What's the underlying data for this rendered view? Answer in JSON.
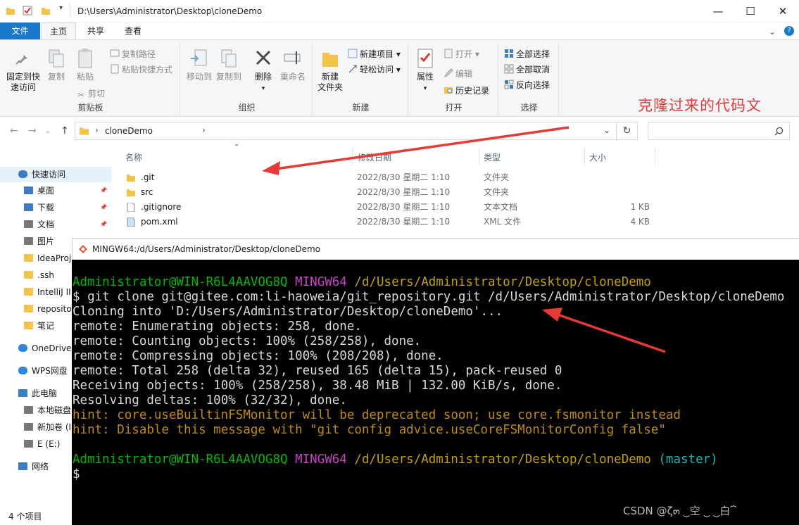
{
  "window": {
    "path": "D:\\Users\\Administrator\\Desktop\\cloneDemo",
    "minimize": "—",
    "maximize": "☐",
    "close": "✕"
  },
  "ribbon_tabs": [
    "文件",
    "主页",
    "共享",
    "查看"
  ],
  "ribbon": {
    "clipboard": {
      "pin": [
        "固定到快",
        "速访问"
      ],
      "copy": "复制",
      "paste": "粘贴",
      "copy_path": "复制路径",
      "paste_shortcut": "粘贴快捷方式",
      "cut": "剪切",
      "group": "剪贴板"
    },
    "organize": {
      "move_to": "移动到",
      "copy_to": "复制到",
      "delete": "删除",
      "rename": "重命名",
      "group": "组织"
    },
    "new": {
      "new_folder": [
        "新建",
        "文件夹"
      ],
      "new_item": "新建项目",
      "easy_access": "轻松访问",
      "group": "新建"
    },
    "open": {
      "properties": "属性",
      "open": "打开",
      "edit": "编辑",
      "history": "历史记录",
      "group": "打开"
    },
    "select": {
      "select_all": "全部选择",
      "select_none": "全部取消",
      "invert": "反向选择",
      "group": "选择"
    }
  },
  "address": {
    "crumb": "cloneDemo"
  },
  "sidebar": [
    {
      "label": "快速访问",
      "pinned": false
    },
    {
      "label": "桌面",
      "pinned": true
    },
    {
      "label": "下载",
      "pinned": true
    },
    {
      "label": "文档",
      "pinned": true
    },
    {
      "label": "图片",
      "pinned": true
    },
    {
      "label": "IdeaProj",
      "pinned": false
    },
    {
      "label": ".ssh",
      "pinned": false
    },
    {
      "label": "IntelliJ II",
      "pinned": false
    },
    {
      "label": "reposito",
      "pinned": false
    },
    {
      "label": "笔记",
      "pinned": false
    },
    {
      "label": "OneDrive",
      "pinned": false
    },
    {
      "label": "WPS网盘",
      "pinned": false
    },
    {
      "label": "此电脑",
      "pinned": false
    },
    {
      "label": "本地磁盘",
      "pinned": false
    },
    {
      "label": "新加卷 (I",
      "pinned": false
    },
    {
      "label": "E (E:)",
      "pinned": false
    },
    {
      "label": "网络",
      "pinned": false
    }
  ],
  "columns": {
    "name": "名称",
    "date": "修改日期",
    "type": "类型",
    "size": "大小"
  },
  "files": [
    {
      "name": ".git",
      "date": "2022/8/30 星期二 1:10",
      "type": "文件夹",
      "size": "",
      "icon": "folder"
    },
    {
      "name": "src",
      "date": "2022/8/30 星期二 1:10",
      "type": "文件夹",
      "size": "",
      "icon": "folder"
    },
    {
      "name": ".gitignore",
      "date": "2022/8/30 星期二 1:10",
      "type": "文本文档",
      "size": "1 KB",
      "icon": "text-file"
    },
    {
      "name": "pom.xml",
      "date": "2022/8/30 星期二 1:10",
      "type": "XML 文件",
      "size": "4 KB",
      "icon": "xml-file"
    }
  ],
  "status": "4 个项目",
  "terminal": {
    "title": "MINGW64:/d/Users/Administrator/Desktop/cloneDemo",
    "prompt_user": "Administrator@WIN-R6L4AAVOG8Q",
    "prompt_env": "MINGW64",
    "prompt_path": "/d/Users/Administrator/Desktop/cloneDemo",
    "branch": "(master)",
    "command": "$ git clone git@gitee.com:li-haoweia/git_repository.git /d/Users/Administrator/Desktop/cloneDemo",
    "output": [
      "Cloning into 'D:/Users/Administrator/Desktop/cloneDemo'...",
      "remote: Enumerating objects: 258, done.",
      "remote: Counting objects: 100% (258/258), done.",
      "remote: Compressing objects: 100% (208/208), done.",
      "remote: Total 258 (delta 32), reused 165 (delta 15), pack-reused 0",
      "Receiving objects: 100% (258/258), 38.48 MiB | 132.00 KiB/s, done.",
      "Resolving deltas: 100% (32/32), done."
    ],
    "hints": [
      "hint: core.useBuiltinFSMonitor will be deprecated soon; use core.fsmonitor instead",
      "hint: Disable this message with \"git config advice.useCoreFSMonitorConfig false\""
    ],
    "cursor_prompt": "$"
  },
  "annotation": "克隆过来的代码文",
  "watermark": "CSDN @ζ๓ ⏟空 ⏟ ⏟白⏞",
  "colors": {
    "accent": "#1979ca",
    "annotation": "#e53a36",
    "terminal_bg": "#000000"
  }
}
